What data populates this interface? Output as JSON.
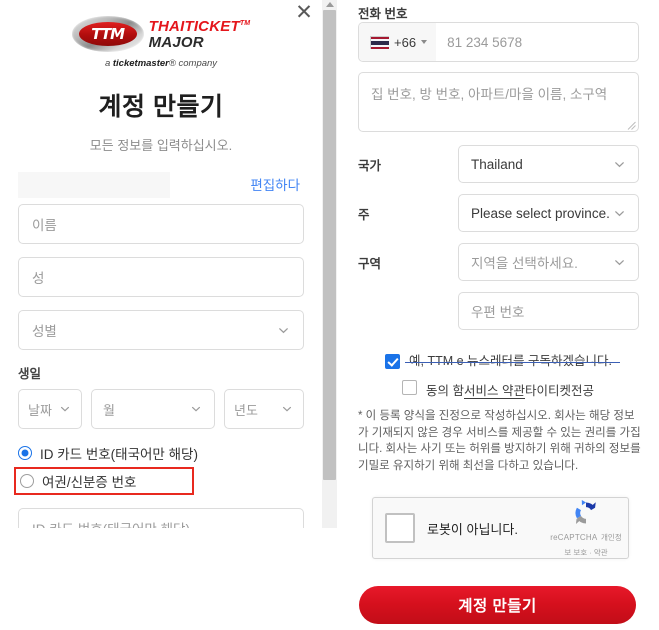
{
  "window": {
    "close_icon": "close-icon"
  },
  "left_panel": {
    "logo": {
      "mark_text": "TTM",
      "line1": "THAITICKET",
      "line1_sup": "TM",
      "line2": "MAJOR",
      "tagline_pre": "a ",
      "tagline_brand": "ticketmaster",
      "tagline_sup": "®",
      "tagline_post": " company"
    },
    "title": "계정 만들기",
    "subtitle": "모든 정보를 입력하십시오.",
    "edit_link": "편집하다",
    "fields": {
      "first_name_placeholder": "이름",
      "last_name_placeholder": "성",
      "gender_placeholder": "성별",
      "dob_label": "생일",
      "dob_day": "날짜",
      "dob_month": "월",
      "dob_year": "년도",
      "id_input_placeholder": "ID 카드 번호(태국어만 해당)"
    },
    "id_type": {
      "option_id_card": "ID 카드 번호(태국어만 해당)",
      "option_passport": "여권/신분증 번호",
      "selected": "option_id_card",
      "highlight_color": "#e8291f"
    }
  },
  "right_panel": {
    "phone_label": "전화 번호",
    "phone_country_code": "+66",
    "phone_placeholder": "81 234 5678",
    "address_placeholder": "집 번호, 방 번호, 아파트/마을 이름, 소구역",
    "country_label": "국가",
    "country_value": "Thailand",
    "province_label": "주",
    "province_value": "Please select province.",
    "district_label": "구역",
    "district_value": "지역을 선택하세요.",
    "postal_placeholder": "우편 번호",
    "newsletter_checkbox": {
      "label": "예, TTM e 뉴스레터를 구독하겠습니다.",
      "checked": true
    },
    "terms_checkbox": {
      "label_pre": "동의 함",
      "label_link": "서비스 약관",
      "label_post": "타이티켓전공",
      "checked": false
    },
    "disclaimer": "* 이 등록 양식을 진정으로 작성하십시오. 회사는 해당 정보가 기재되지 않은 경우 서비스를 제공할 수 있는 권리를 가집니다. 회사는 사기 또는 허위를 방지하기 위해 귀하의 정보를 기밀로 유지하기 위해 최선을 다하고 있습니다.",
    "recaptcha": {
      "label": "로봇이 아닙니다.",
      "brand": "reCAPTCHA",
      "terms": "개인정보 보호 · 약관",
      "checked": false
    },
    "submit_label": "계정 만들기",
    "submit_color": "#d5101d"
  }
}
